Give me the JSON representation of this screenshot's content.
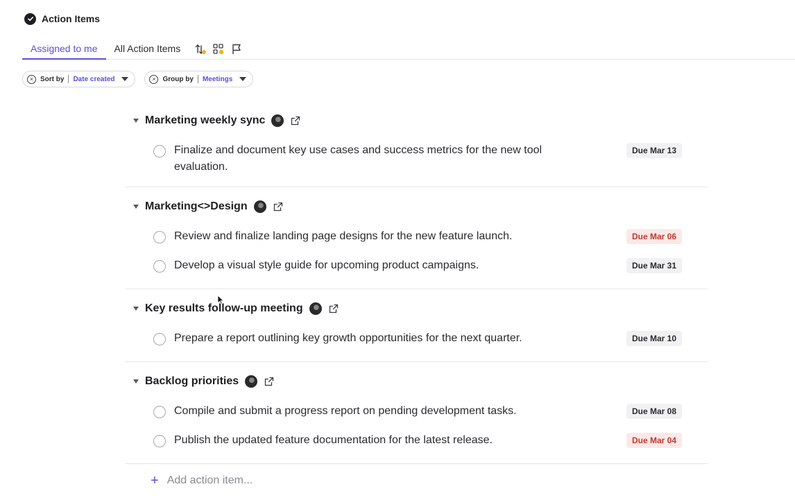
{
  "header": {
    "title": "Action Items",
    "icon": "check-circle-icon"
  },
  "tabs": [
    {
      "label": "Assigned to me",
      "active": true
    },
    {
      "label": "All Action Items",
      "active": false
    }
  ],
  "tab_icons": [
    "sort-icon",
    "grid-icon",
    "flag-icon"
  ],
  "filters": {
    "sort": {
      "label": "Sort by",
      "value": "Date created"
    },
    "group": {
      "label": "Group by",
      "value": "Meetings"
    }
  },
  "groups": [
    {
      "title": "Marketing weekly sync",
      "items": [
        {
          "text": "Finalize and document key use cases and success metrics for the new tool evaluation.",
          "due": "Due Mar 13",
          "overdue": false
        }
      ]
    },
    {
      "title": "Marketing<>Design",
      "items": [
        {
          "text": "Review and finalize landing page designs for the new feature launch.",
          "due": "Due Mar 06",
          "overdue": true
        },
        {
          "text": "Develop a visual style guide for upcoming product campaigns.",
          "due": "Due Mar 31",
          "overdue": false
        }
      ]
    },
    {
      "title": "Key results follow-up meeting",
      "items": [
        {
          "text": "Prepare a report outlining key growth opportunities for the next quarter.",
          "due": "Due Mar 10",
          "overdue": false
        }
      ]
    },
    {
      "title": "Backlog priorities",
      "items": [
        {
          "text": "Compile and submit a progress report on pending development tasks.",
          "due": "Due Mar 08",
          "overdue": false
        },
        {
          "text": "Publish the updated feature documentation for the latest release.",
          "due": "Due Mar 04",
          "overdue": true
        }
      ]
    }
  ],
  "add_item": {
    "label": "Add action item..."
  },
  "colors": {
    "accent": "#5b4fd6",
    "overdue_text": "#c0392b",
    "overdue_bg": "#fde8e8",
    "due_bg": "#f1f1f3"
  }
}
